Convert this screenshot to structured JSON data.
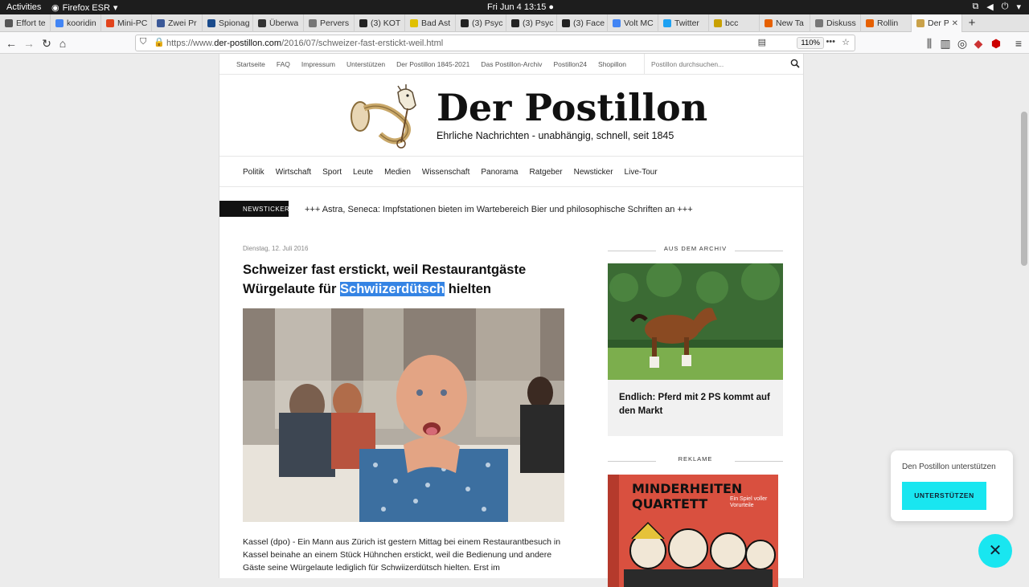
{
  "system": {
    "activities": "Activities",
    "app_name": "Firefox ESR",
    "clock": "Fri Jun 4  13:15"
  },
  "tabs": [
    {
      "label": "Effort te",
      "color": "#555555"
    },
    {
      "label": "kooridin",
      "color": "#4285f4"
    },
    {
      "label": "Mini-PC",
      "color": "#e2441c"
    },
    {
      "label": "Zwei Pr",
      "color": "#3b5998"
    },
    {
      "label": "Spionag",
      "color": "#1a4b8c"
    },
    {
      "label": "Überwa",
      "color": "#333333"
    },
    {
      "label": "Pervers",
      "color": "#777777"
    },
    {
      "label": "(3) KOT",
      "color": "#222222"
    },
    {
      "label": "Bad Ast",
      "color": "#e0c000"
    },
    {
      "label": "(3) Psyc",
      "color": "#222222"
    },
    {
      "label": "(3) Psyc",
      "color": "#222222"
    },
    {
      "label": "(3) Face",
      "color": "#222222"
    },
    {
      "label": "Volt MC",
      "color": "#4285f4"
    },
    {
      "label": "Twitter",
      "color": "#1da1f2"
    },
    {
      "label": "bcc",
      "color": "#c8a000"
    },
    {
      "label": "New Ta",
      "color": "#e66000"
    },
    {
      "label": "Diskuss",
      "color": "#777777"
    },
    {
      "label": "Rollin",
      "color": "#e66000"
    },
    {
      "label": "Der P",
      "color": "#caa24a"
    }
  ],
  "urlbar": {
    "prefix": "https://www.",
    "domain": "der-postillon.com",
    "path": "/2016/07/schweizer-fast-erstickt-weil.html",
    "zoom": "110%"
  },
  "site": {
    "topnav": [
      "Startseite",
      "FAQ",
      "Impressum",
      "Unterstützen",
      "Der Postillon 1845-2021",
      "Das Postillon-Archiv",
      "Postillon24",
      "Shopillon"
    ],
    "search_placeholder": "Postillon durchsuchen...",
    "brand": "Der Postillon",
    "tagline": "Ehrliche Nachrichten - unabhängig, schnell, seit 1845",
    "categories": [
      "Politik",
      "Wirtschaft",
      "Sport",
      "Leute",
      "Medien",
      "Wissenschaft",
      "Panorama",
      "Ratgeber",
      "Newsticker",
      "Live-Tour"
    ],
    "ticker_tag": "NEWSTICKER",
    "ticker_text": "+++ Astra, Seneca: Impfstationen bieten im Wartebereich Bier und philosophische Schriften an +++"
  },
  "article": {
    "date": "Dienstag, 12. Juli 2016",
    "title_pre": "Schweizer fast erstickt, weil Restaurantgäste Würgelaute für ",
    "title_hl": "Schwiizerdütsch",
    "title_post": " hielten",
    "body": "Kassel (dpo) - Ein Mann aus Zürich ist gestern Mittag bei einem Restaurantbesuch in Kassel beinahe an einem Stück Hühnchen erstickt, weil die Bedienung und andere Gäste seine Würgelaute lediglich für Schwiizerdütsch hielten. Erst im"
  },
  "sidebar": {
    "archive_heading": "AUS DEM ARCHIV",
    "archive_title": "Endlich: Pferd mit 2 PS kommt auf den Markt",
    "ad_heading": "REKLAME",
    "ad_line1": "MINDERHEITEN",
    "ad_line2": "QUARTETT",
    "ad_sub": "Ein Spiel voller Vorurteile"
  },
  "popup": {
    "message": "Den Postillon unterstützen",
    "button": "UNTERSTÜTZEN",
    "close": "✕"
  }
}
